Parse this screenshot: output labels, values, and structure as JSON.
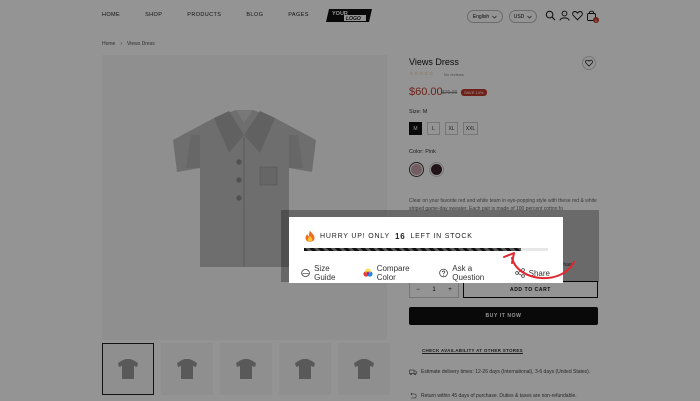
{
  "header": {
    "nav": [
      "HOME",
      "SHOP",
      "PRODUCTS",
      "BLOG",
      "PAGES"
    ],
    "logo_top": "YOUR",
    "logo_bottom": "LOGO",
    "language": "English",
    "currency": "USD",
    "cart_count": "0"
  },
  "breadcrumb": {
    "home": "Home",
    "sep": "›",
    "current": "Views Dress"
  },
  "product": {
    "title": "Views Dress",
    "stars": "☆☆☆☆☆",
    "reviews": "No reviews",
    "price": "$60.00",
    "old_price": "$70.00",
    "save_badge": "SAVE 14%",
    "size_label": "Size: M",
    "sizes": [
      "M",
      "L",
      "XL",
      "XXL"
    ],
    "selected_size": "M",
    "color_label": "Color: Pink",
    "colors": [
      "#c9a0a6",
      "#3a2228"
    ],
    "description": "Clear on your favorite red and white team in eye-popping style with these red & white striped game-day sweater. Each pair is made of 100 percent cotton fo",
    "quantity": "1",
    "qty_minus": "−",
    "qty_plus": "+",
    "add_to_cart": "ADD TO CART",
    "buy_now": "BUY IT NOW",
    "check_stores": "CHECK AVAILABILITY AT OTHER STORES",
    "delivery_text": "Estimate delivery times: 12-26 days (International), 3-6 days (United States).",
    "returns_text": "Return within 45 days of purchase. Duties & taxes are non-refundable."
  },
  "stock": {
    "prefix": "HURRY UP! ONLY",
    "count": "16",
    "suffix": "LEFT IN STOCK",
    "progress_fraction": 0.89
  },
  "tools": {
    "size_guide": "Size Guide",
    "compare_color": "Compare Color",
    "ask_question": "Ask a Question",
    "share": "Share"
  },
  "colors": {
    "accent_red": "#c0392b",
    "overlay": "rgba(0,0,0,0.42)",
    "annotation_arrow": "#e0282e"
  }
}
